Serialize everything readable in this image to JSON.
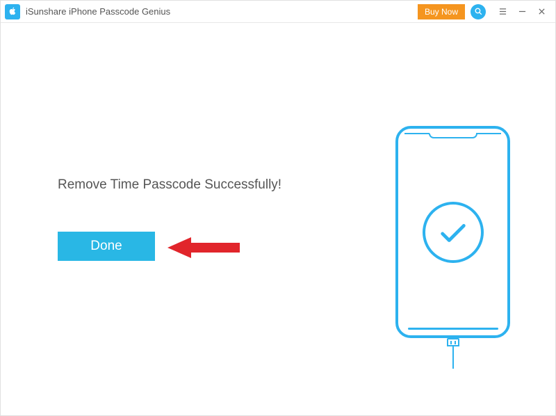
{
  "titlebar": {
    "app_name": "iSunshare iPhone Passcode Genius",
    "buy_now_label": "Buy Now"
  },
  "main": {
    "success_message": "Remove Time Passcode Successfully!",
    "done_label": "Done"
  },
  "colors": {
    "accent": "#2db2ef",
    "buy_now": "#f5951f",
    "done_button": "#29b7e5",
    "arrow": "#e1252b"
  },
  "icons": {
    "app": "apple-logo-icon",
    "search": "search-icon",
    "menu": "hamburger-icon",
    "minimize": "minimize-icon",
    "close": "close-icon",
    "checkmark": "checkmark-icon"
  }
}
